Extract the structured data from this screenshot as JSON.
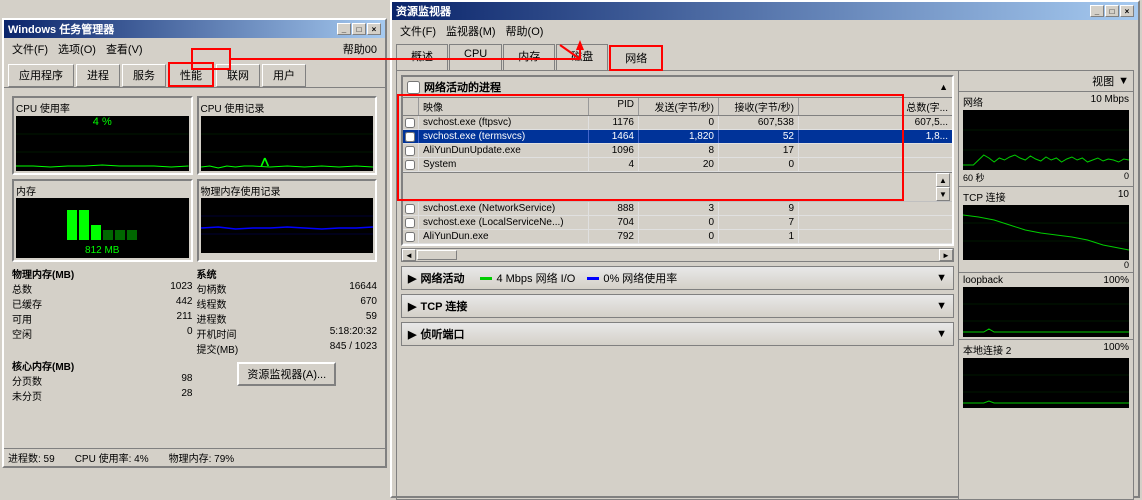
{
  "taskmanager": {
    "title": "Windows 任务管理器",
    "menu": [
      "文件(F)",
      "选项(O)",
      "查看(V)",
      "帮助(H)"
    ],
    "menu_time": "帮助00",
    "tabs": [
      "应用程序",
      "进程",
      "服务",
      "性能",
      "联网",
      "用户"
    ],
    "active_tab": "性能",
    "cpu_usage": {
      "label": "CPU 使用率",
      "value": "4 %"
    },
    "cpu_history": {
      "label": "CPU 使用记录"
    },
    "memory": {
      "label": "内存",
      "value": "812 MB"
    },
    "physical_memory_history": {
      "label": "物理内存使用记录"
    },
    "sys_info": {
      "label": "系统",
      "rows": [
        {
          "label": "句柄数",
          "value": "16644"
        },
        {
          "label": "线程数",
          "value": "670"
        },
        {
          "label": "进程数",
          "value": "59"
        },
        {
          "label": "开机时间",
          "value": "5:18:20:32"
        },
        {
          "label": "提交(MB)",
          "value": "845 / 1023"
        }
      ]
    },
    "physical_memory": {
      "label": "物理内存(MB)",
      "rows": [
        {
          "label": "总数",
          "value": "1023"
        },
        {
          "label": "已缓存",
          "value": "442"
        },
        {
          "label": "可用",
          "value": "211"
        },
        {
          "label": "空闲",
          "value": "0"
        }
      ]
    },
    "kernel_memory": {
      "label": "核心内存(MB)",
      "rows": [
        {
          "label": "分页数",
          "value": "98"
        },
        {
          "label": "未分页",
          "value": "28"
        }
      ]
    },
    "resource_btn": "资源监视器(A)...",
    "status": {
      "processes": "进程数: 59",
      "cpu": "CPU 使用率: 4%",
      "memory": "物理内存: 79%"
    }
  },
  "resource_monitor": {
    "title": "资源监视器",
    "menu": [
      "文件(F)",
      "监视器(M)",
      "帮助(O)"
    ],
    "tabs": [
      "概述",
      "CPU",
      "内存",
      "磁盘",
      "网络"
    ],
    "active_tab": "网络",
    "network_section": {
      "title": "网络活动的进程",
      "columns": [
        "映像",
        "PID",
        "发送(字节/秒)",
        "接收(字节/秒)",
        "总数(字..."
      ],
      "rows": [
        {
          "checkbox": false,
          "name": "svchost.exe (ftpsvc)",
          "pid": "1176",
          "send": "0",
          "recv": "607,538",
          "total": "607,5...",
          "highlighted": false
        },
        {
          "checkbox": false,
          "name": "svchost.exe (termsvcs)",
          "pid": "1464",
          "send": "1,820",
          "recv": "52",
          "total": "1,8...",
          "highlighted": true
        },
        {
          "checkbox": false,
          "name": "AliYunDunUpdate.exe",
          "pid": "1096",
          "send": "8",
          "recv": "17",
          "total": "",
          "highlighted": false
        },
        {
          "checkbox": false,
          "name": "System",
          "pid": "4",
          "send": "20",
          "recv": "0",
          "total": "",
          "highlighted": false
        }
      ],
      "rows2": [
        {
          "checkbox": false,
          "name": "svchost.exe (NetworkService)",
          "pid": "888",
          "send": "3",
          "recv": "9",
          "total": ""
        },
        {
          "checkbox": false,
          "name": "svchost.exe (LocalServiceNe...)",
          "pid": "704",
          "send": "0",
          "recv": "7",
          "total": ""
        },
        {
          "checkbox": false,
          "name": "AliYunDun.exe",
          "pid": "792",
          "send": "0",
          "recv": "1",
          "total": ""
        }
      ]
    },
    "network_activity": {
      "title": "网络活动",
      "legend1_color": "#00cc00",
      "legend1_label": "4 Mbps 网络 I/O",
      "legend2_color": "#0000ff",
      "legend2_label": "0% 网络使用率"
    },
    "tcp_connections": {
      "title": "TCP 连接"
    },
    "listening_ports": {
      "title": "侦听端口"
    },
    "right_panel": {
      "header": "视图",
      "graphs": [
        {
          "name": "网络",
          "value": "10 Mbps",
          "secondary_label": "60 秒",
          "bottom_labels": [
            "",
            "0"
          ],
          "tcp_label": "TCP 连接",
          "tcp_value": "10"
        },
        {
          "name": "loopback",
          "value": "100%"
        },
        {
          "name": "本地连接 2",
          "value": "100%"
        }
      ]
    }
  },
  "icons": {
    "minimize": "_",
    "maximize": "□",
    "close": "×",
    "expand": "▼",
    "collapse": "▲",
    "arrow_up": "▲",
    "arrow_down": "▼",
    "arrow_right": "►"
  }
}
